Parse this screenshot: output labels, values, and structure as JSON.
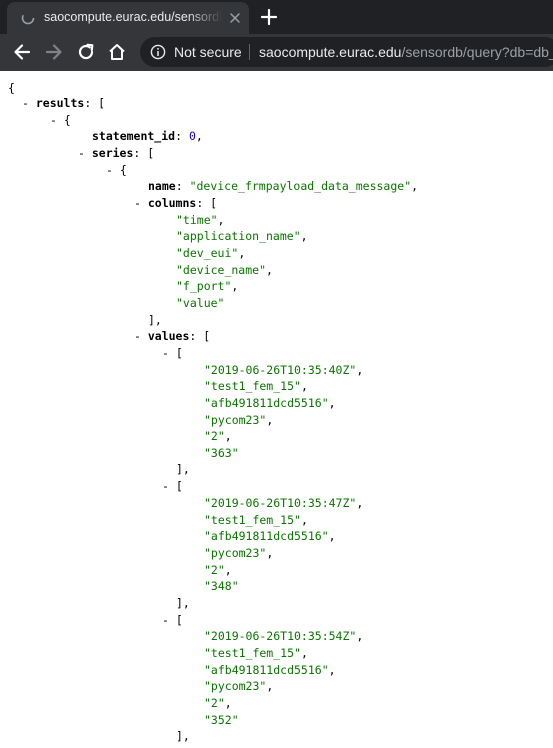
{
  "browser": {
    "tab": {
      "title": "saocompute.eurac.edu/sensordb"
    },
    "address_bar": {
      "security_label": "Not secure",
      "url_host": "saocompute.eurac.edu",
      "url_path": "/sensordb/query?db=db_"
    },
    "colors": {
      "frame": "#202124",
      "toolbar": "#35363a",
      "omnibox": "#202124"
    },
    "icons": {
      "tab_favicon": "loading-globe-icon",
      "tab_close": "close-icon",
      "new_tab": "plus-icon",
      "back": "arrow-left-icon",
      "forward": "arrow-right-icon",
      "reload": "reload-icon",
      "home": "home-icon",
      "site_info": "info-icon"
    }
  },
  "json_viewer": {
    "colors": {
      "string": "#0b7500",
      "number": "#1a01cc",
      "key": "#000000"
    },
    "keys": {
      "results": "results",
      "statement_id": "statement_id",
      "series": "series",
      "name": "name",
      "columns": "columns",
      "values": "values"
    },
    "statement_id": "0",
    "series_name": "\"device_frmpayload_data_message\"",
    "columns": [
      "\"time\"",
      "\"application_name\"",
      "\"dev_eui\"",
      "\"device_name\"",
      "\"f_port\"",
      "\"value\""
    ],
    "rows": [
      [
        "\"2019-06-26T10:35:40Z\"",
        "\"test1_fem_15\"",
        "\"afb491811dcd5516\"",
        "\"pycom23\"",
        "\"2\"",
        "\"363\""
      ],
      [
        "\"2019-06-26T10:35:47Z\"",
        "\"test1_fem_15\"",
        "\"afb491811dcd5516\"",
        "\"pycom23\"",
        "\"2\"",
        "\"348\""
      ],
      [
        "\"2019-06-26T10:35:54Z\"",
        "\"test1_fem_15\"",
        "\"afb491811dcd5516\"",
        "\"pycom23\"",
        "\"2\"",
        "\"352\""
      ]
    ]
  }
}
